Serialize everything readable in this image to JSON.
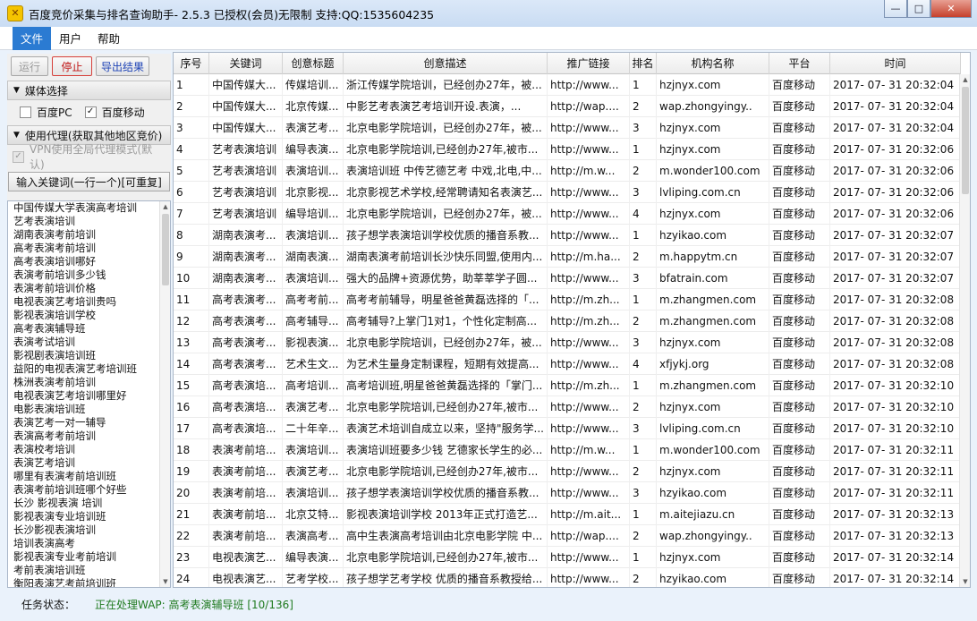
{
  "window": {
    "title": "百度竞价采集与排名查询助手- 2.5.3 已授权(会员)无限制    支持:QQ:1535604235",
    "minimize": "—",
    "maximize": "□",
    "close": "✕"
  },
  "menu": {
    "items": [
      {
        "label": "文件",
        "active": true
      },
      {
        "label": "用户",
        "active": false
      },
      {
        "label": "帮助",
        "active": false
      }
    ]
  },
  "toolbar": {
    "run_label": "运行",
    "stop_label": "停止",
    "export_label": "导出结果"
  },
  "media": {
    "header": "媒体选择",
    "pc_label": "百度PC",
    "pc_checked": false,
    "mobile_label": "百度移动",
    "mobile_checked": true
  },
  "proxy": {
    "header": "使用代理(获取其他地区竞价)",
    "vpn_label": "VPN使用全局代理模式(默认)",
    "vpn_checked": true
  },
  "keywords": {
    "button_label": "输入关键词(一行一个)[可重复]",
    "items": [
      "中国传媒大学表演高考培训",
      "艺考表演培训",
      "湖南表演考前培训",
      "高考表演考前培训",
      "高考表演培训哪好",
      "表演考前培训多少钱",
      "表演考前培训价格",
      "电视表演艺考培训贵吗",
      "影视表演培训学校",
      "高考表演辅导班",
      "表演考试培训",
      "影视剧表演培训班",
      "益阳的电视表演艺考培训班",
      "株洲表演考前培训",
      "电视表演艺考培训哪里好",
      "电影表演培训班",
      "表演艺考一对一辅导",
      "表演高考考前培训",
      "表演校考培训",
      "表演艺考培训",
      "哪里有表演考前培训班",
      "表演考前培训班哪个好些",
      "长沙 影视表演 培训",
      "影视表演专业培训班",
      "长沙影视表演培训",
      "培训表演高考",
      "影视表演专业考前培训",
      "考前表演培训班",
      "衡阳表演艺考前培训班"
    ]
  },
  "table": {
    "columns": [
      "序号",
      "关键词",
      "创意标题",
      "创意描述",
      "推广链接",
      "排名",
      "机构名称",
      "平台",
      "时间"
    ],
    "rows": [
      [
        "1",
        "中国传媒大...",
        "传媒培训...",
        "浙江传媒学院培训，已经创办27年，被...",
        "http://www...",
        "1",
        "hzjnyx.com",
        "百度移动",
        "2017- 07- 31 20:32:04"
      ],
      [
        "2",
        "中国传媒大...",
        "北京传媒...",
        "中影艺考表演艺考培训开设.表演，...",
        "http://wap....",
        "2",
        "wap.zhongyingy..",
        "百度移动",
        "2017- 07- 31 20:32:04"
      ],
      [
        "3",
        "中国传媒大...",
        "表演艺考...",
        "北京电影学院培训，已经创办27年，被...",
        "http://www...",
        "3",
        "hzjnyx.com",
        "百度移动",
        "2017- 07- 31 20:32:04"
      ],
      [
        "4",
        "艺考表演培训",
        "编导表演...",
        "北京电影学院培训,已经创办27年,被市...",
        "http://www...",
        "1",
        "hzjnyx.com",
        "百度移动",
        "2017- 07- 31 20:32:06"
      ],
      [
        "5",
        "艺考表演培训",
        "表演培训...",
        "表演培训班 中传艺德艺考 中戏,北电,中...",
        "http://m.w...",
        "2",
        "m.wonder100.com",
        "百度移动",
        "2017- 07- 31 20:32:06"
      ],
      [
        "6",
        "艺考表演培训",
        "北京影视...",
        "北京影视艺术学校,经常聘请知名表演艺...",
        "http://www...",
        "3",
        "lvliping.com.cn",
        "百度移动",
        "2017- 07- 31 20:32:06"
      ],
      [
        "7",
        "艺考表演培训",
        "编导培训...",
        "北京电影学院培训，已经创办27年，被...",
        "http://www...",
        "4",
        "hzjnyx.com",
        "百度移动",
        "2017- 07- 31 20:32:06"
      ],
      [
        "8",
        "湖南表演考...",
        "表演培训...",
        "孩子想学表演培训学校优质的播音系教...",
        "http://www...",
        "1",
        "hzyikao.com",
        "百度移动",
        "2017- 07- 31 20:32:07"
      ],
      [
        "9",
        "湖南表演考...",
        "湖南表演...",
        "湖南表演考前培训长沙快乐同盟,使用内...",
        "http://m.ha...",
        "2",
        "m.happytm.cn",
        "百度移动",
        "2017- 07- 31 20:32:07"
      ],
      [
        "10",
        "湖南表演考...",
        "表演培训...",
        "强大的品牌+资源优势，助莘莘学子圆...",
        "http://www...",
        "3",
        "bfatrain.com",
        "百度移动",
        "2017- 07- 31 20:32:07"
      ],
      [
        "11",
        "高考表演考...",
        "高考考前...",
        "高考考前辅导，明星爸爸黄磊选择的「...",
        "http://m.zh...",
        "1",
        "m.zhangmen.com",
        "百度移动",
        "2017- 07- 31 20:32:08"
      ],
      [
        "12",
        "高考表演考...",
        "高考辅导...",
        "高考辅导?上掌门1对1，个性化定制高...",
        "http://m.zh...",
        "2",
        "m.zhangmen.com",
        "百度移动",
        "2017- 07- 31 20:32:08"
      ],
      [
        "13",
        "高考表演考...",
        "影视表演...",
        "北京电影学院培训，已经创办27年，被...",
        "http://www...",
        "3",
        "hzjnyx.com",
        "百度移动",
        "2017- 07- 31 20:32:08"
      ],
      [
        "14",
        "高考表演考...",
        "艺术生文...",
        "为艺术生量身定制课程，短期有效提高...",
        "http://www...",
        "4",
        "xfjykj.org",
        "百度移动",
        "2017- 07- 31 20:32:08"
      ],
      [
        "15",
        "高考表演培...",
        "高考培训...",
        "高考培训班,明星爸爸黄磊选择的「掌门...",
        "http://m.zh...",
        "1",
        "m.zhangmen.com",
        "百度移动",
        "2017- 07- 31 20:32:10"
      ],
      [
        "16",
        "高考表演培...",
        "表演艺考...",
        "北京电影学院培训,已经创办27年,被市...",
        "http://www...",
        "2",
        "hzjnyx.com",
        "百度移动",
        "2017- 07- 31 20:32:10"
      ],
      [
        "17",
        "高考表演培...",
        "二十年辛...",
        "表演艺术培训自成立以来，坚持\"服务学...",
        "http://www...",
        "3",
        "lvliping.com.cn",
        "百度移动",
        "2017- 07- 31 20:32:10"
      ],
      [
        "18",
        "表演考前培...",
        "表演培训...",
        "表演培训班要多少钱 艺德家长学生的必...",
        "http://m.w...",
        "1",
        "m.wonder100.com",
        "百度移动",
        "2017- 07- 31 20:32:11"
      ],
      [
        "19",
        "表演考前培...",
        "表演艺考...",
        "北京电影学院培训,已经创办27年,被市...",
        "http://www...",
        "2",
        "hzjnyx.com",
        "百度移动",
        "2017- 07- 31 20:32:11"
      ],
      [
        "20",
        "表演考前培...",
        "表演培训...",
        "孩子想学表演培训学校优质的播音系教...",
        "http://www...",
        "3",
        "hzyikao.com",
        "百度移动",
        "2017- 07- 31 20:32:11"
      ],
      [
        "21",
        "表演考前培...",
        "北京艾特...",
        "影视表演培训学校 2013年正式打造艺...",
        "http://m.ait...",
        "1",
        "m.aitejiazu.cn",
        "百度移动",
        "2017- 07- 31 20:32:13"
      ],
      [
        "22",
        "表演考前培...",
        "表演高考...",
        "高中生表演高考培训由北京电影学院 中...",
        "http://wap....",
        "2",
        "wap.zhongyingy..",
        "百度移动",
        "2017- 07- 31 20:32:13"
      ],
      [
        "23",
        "电视表演艺...",
        "编导表演...",
        "北京电影学院培训,已经创办27年,被市...",
        "http://www...",
        "1",
        "hzjnyx.com",
        "百度移动",
        "2017- 07- 31 20:32:14"
      ],
      [
        "24",
        "电视表演艺...",
        "艺考学校...",
        "孩子想学艺考学校 优质的播音系教授给...",
        "http://www...",
        "2",
        "hzyikao.com",
        "百度移动",
        "2017- 07- 31 20:32:14"
      ]
    ]
  },
  "status": {
    "label": "任务状态：",
    "value": "正在处理WAP:  高考表演辅导班  [10/136]"
  }
}
